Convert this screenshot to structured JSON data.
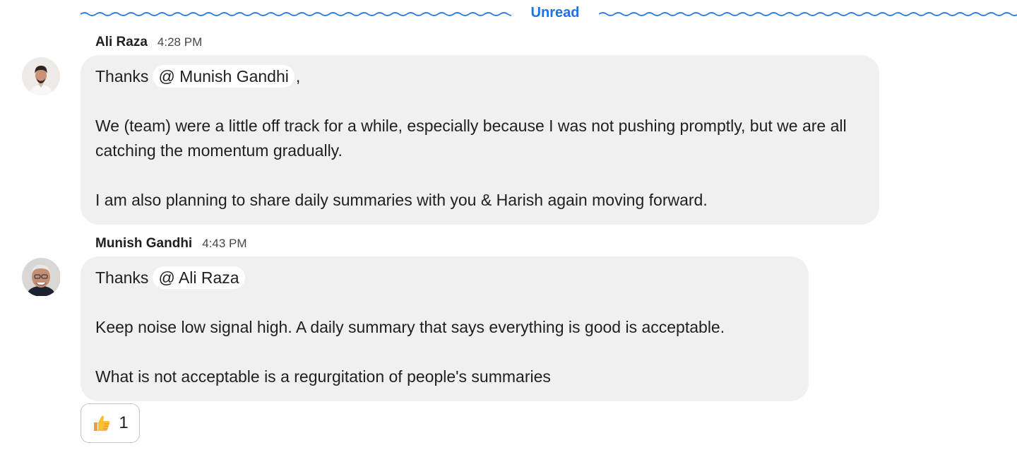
{
  "divider": {
    "label": "Unread",
    "color": "#1a73e8"
  },
  "messages": [
    {
      "sender": "Ali Raza",
      "time": "4:28 PM",
      "avatar_icon": "user-avatar-photo",
      "lines": {
        "greeting": "Thanks",
        "mention": "@ Munish Gandhi",
        "after_mention": ",",
        "paragraph_1": "We (team) were a little off track for a while, especially because I was not pushing promptly, but we are all catching the momentum gradually.",
        "paragraph_2": "I am also planning to share daily summaries with you & Harish again moving forward."
      }
    },
    {
      "sender": "Munish Gandhi",
      "time": "4:43 PM",
      "avatar_icon": "user-avatar-photo",
      "lines": {
        "greeting": "Thanks",
        "mention": "@ Ali Raza",
        "paragraph_1": "Keep noise low signal high. A daily summary that says everything is good is acceptable.",
        "paragraph_2": "What is not acceptable is a regurgitation of people's summaries"
      }
    }
  ],
  "reaction": {
    "emoji_icon": "thumbs-up-icon",
    "count": "1"
  },
  "colors": {
    "bubble_background": "#f0f0f0",
    "mention_background": "#ffffff",
    "text": "#1f1f1f",
    "timestamp": "#444746"
  }
}
